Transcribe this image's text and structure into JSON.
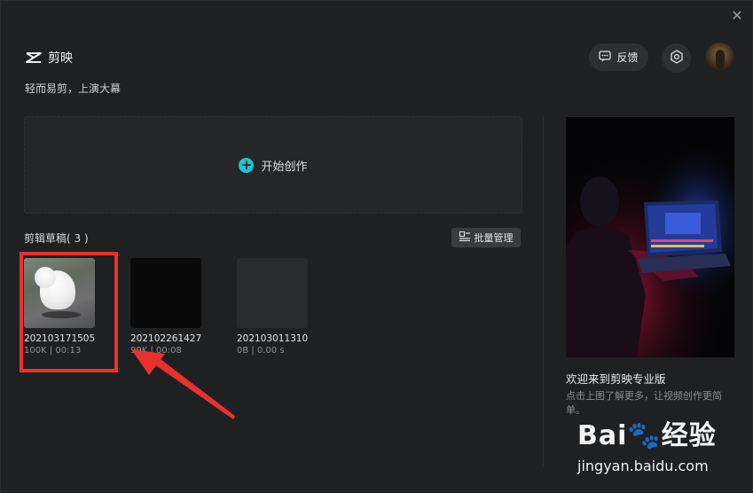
{
  "window": {
    "close_icon": "close-icon"
  },
  "header": {
    "app_name": "剪映",
    "tagline": "轻而易剪，上演大幕",
    "feedback_label": "反馈",
    "settings_icon": "hexagon-gear-icon"
  },
  "create": {
    "label": "开始创作"
  },
  "drafts": {
    "title": "剪辑草稿( 3 )",
    "batch_label": "批量管理",
    "items": [
      {
        "name": "202103171505",
        "meta": "100K | 00:13"
      },
      {
        "name": "202102261427",
        "meta": "99K | 00:08"
      },
      {
        "name": "202103011310",
        "meta": "0B | 0.00 s"
      }
    ]
  },
  "promo": {
    "title": "欢迎来到剪映专业版",
    "description": "点击上图了解更多，让视频创作更简单。"
  },
  "watermark": {
    "brand": "Bai",
    "brand_cn": "经验",
    "url": "jingyan.baidu.com"
  },
  "colors": {
    "accent": "#21c3cf",
    "highlight": "#e8312e",
    "background": "#1f2022"
  }
}
